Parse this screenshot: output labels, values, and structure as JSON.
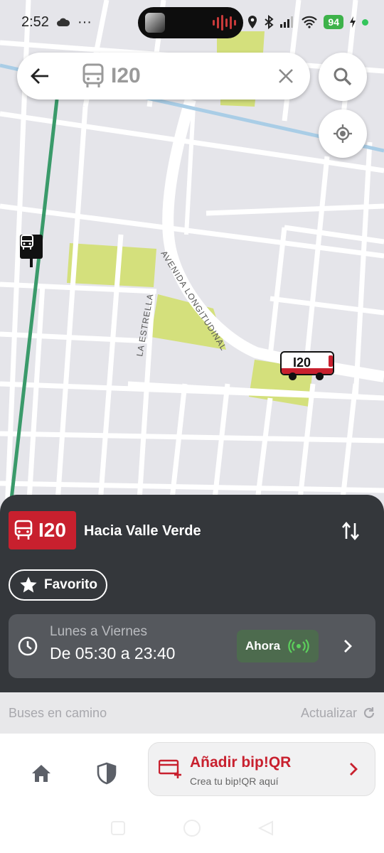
{
  "status_bar": {
    "time": "2:52",
    "dots": "···",
    "battery": "94"
  },
  "search": {
    "route": "I20",
    "back_icon": "arrow-left-icon",
    "bus_icon": "bus-icon",
    "clear_icon": "close-icon"
  },
  "map": {
    "street_1": "AVENIDA LONGITUDINAL",
    "street_2": "LA ESTRELLA",
    "bus_marker_label": "I20"
  },
  "route_panel": {
    "route_number": "I20",
    "direction": "Hacia Valle Verde",
    "favorite_label": "Favorito",
    "schedule_days": "Lunes a Viernes",
    "schedule_hours": "De 05:30 a 23:40",
    "now_label": "Ahora"
  },
  "buses_section": {
    "label": "Buses en camino",
    "refresh_label": "Actualizar"
  },
  "bottom_nav": {
    "bip_title": "Añadir bip!QR",
    "bip_subtitle": "Crea tu bip!QR aquí"
  },
  "colors": {
    "brand_red": "#c8202e",
    "panel_dark": "#34373b",
    "route_line": "#3a9a6a",
    "park": "#d4e07c"
  }
}
